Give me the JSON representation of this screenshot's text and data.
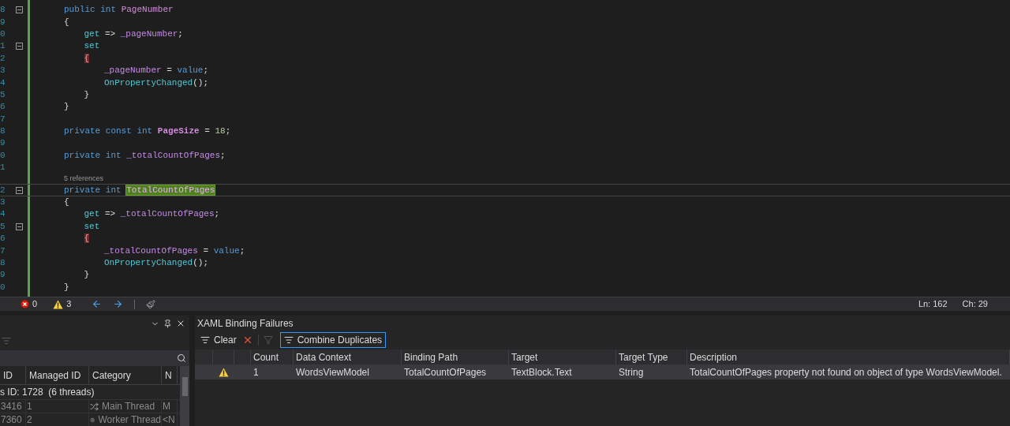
{
  "editor": {
    "lines": [
      {
        "kind": "code",
        "number": "8",
        "fold": true,
        "current": false,
        "tokens": [
          {
            "text": "public int ",
            "kind": "keyword"
          },
          {
            "text": "PageNumber",
            "kind": "property"
          }
        ]
      },
      {
        "kind": "code",
        "number": "9",
        "fold": false,
        "current": false,
        "tokens": [
          {
            "text": "{",
            "kind": "plain"
          }
        ],
        "children": [
          {
            "kind": "code",
            "number": "0",
            "fold": false,
            "current": false,
            "tokens": [
              {
                "text": "get",
                "kind": "accessor"
              },
              {
                "text": " => ",
                "kind": "plain"
              },
              {
                "text": "_pageNumber",
                "kind": "field"
              },
              {
                "text": ";",
                "kind": "plain"
              }
            ]
          },
          {
            "kind": "code",
            "number": "1",
            "fold": true,
            "current": false,
            "tokens": [
              {
                "text": "set",
                "kind": "accessor"
              }
            ]
          },
          {
            "kind": "code",
            "number": "2",
            "fold": false,
            "current": false,
            "tokens": [
              {
                "text": "{",
                "kind": "brace-match"
              }
            ],
            "children": [
              {
                "kind": "code",
                "number": "3",
                "fold": false,
                "current": false,
                "tokens": [
                  {
                    "text": "_pageNumber",
                    "kind": "field"
                  },
                  {
                    "text": " = ",
                    "kind": "plain"
                  },
                  {
                    "text": "value",
                    "kind": "keyword"
                  },
                  {
                    "text": ";",
                    "kind": "plain"
                  }
                ]
              },
              {
                "kind": "code",
                "number": "4",
                "fold": false,
                "current": false,
                "tokens": [
                  {
                    "text": "OnPropertyChanged",
                    "kind": "method"
                  },
                  {
                    "text": "();",
                    "kind": "plain"
                  }
                ]
              }
            ]
          },
          {
            "kind": "code",
            "number": "5",
            "fold": false,
            "current": false,
            "tokens": [
              {
                "text": "}",
                "kind": "plain"
              }
            ]
          }
        ]
      },
      {
        "kind": "code",
        "number": "6",
        "fold": false,
        "current": false,
        "tokens": [
          {
            "text": "}",
            "kind": "plain"
          }
        ]
      },
      {
        "kind": "code",
        "number": "7",
        "fold": false,
        "current": false
      },
      {
        "kind": "code",
        "number": "8",
        "fold": false,
        "current": false,
        "tokens": [
          {
            "text": "private const int ",
            "kind": "keyword"
          },
          {
            "text": "PageSize",
            "kind": "constant"
          },
          {
            "text": " = ",
            "kind": "plain"
          },
          {
            "text": "18",
            "kind": "number"
          },
          {
            "text": ";",
            "kind": "plain"
          }
        ]
      },
      {
        "kind": "code",
        "number": "9",
        "fold": false,
        "current": false
      },
      {
        "kind": "code",
        "number": "0",
        "fold": false,
        "current": false,
        "tokens": [
          {
            "text": "private int ",
            "kind": "keyword"
          },
          {
            "text": "_totalCountOfPages",
            "kind": "field"
          },
          {
            "text": ";",
            "kind": "plain"
          }
        ]
      },
      {
        "kind": "code",
        "number": "1",
        "fold": false,
        "current": false
      },
      {
        "kind": "codelens",
        "text": "5 references"
      },
      {
        "kind": "code",
        "number": "2",
        "fold": true,
        "current": true,
        "tokens": [
          {
            "text": "private int ",
            "kind": "keyword"
          },
          {
            "text": "TotalCountOfPages",
            "kind": "highlight"
          }
        ]
      },
      {
        "kind": "code",
        "number": "3",
        "fold": false,
        "current": false,
        "tokens": [
          {
            "text": "{",
            "kind": "plain"
          }
        ],
        "children": [
          {
            "kind": "code",
            "number": "4",
            "fold": false,
            "current": false,
            "tokens": [
              {
                "text": "get",
                "kind": "accessor"
              },
              {
                "text": " => ",
                "kind": "plain"
              },
              {
                "text": "_totalCountOfPages",
                "kind": "field"
              },
              {
                "text": ";",
                "kind": "plain"
              }
            ]
          },
          {
            "kind": "code",
            "number": "5",
            "fold": true,
            "current": false,
            "tokens": [
              {
                "text": "set",
                "kind": "accessor"
              }
            ]
          },
          {
            "kind": "code",
            "number": "6",
            "fold": false,
            "current": false,
            "tokens": [
              {
                "text": "{",
                "kind": "brace-match"
              }
            ],
            "children": [
              {
                "kind": "code",
                "number": "7",
                "fold": false,
                "current": false,
                "tokens": [
                  {
                    "text": "_totalCountOfPages",
                    "kind": "field"
                  },
                  {
                    "text": " = ",
                    "kind": "plain"
                  },
                  {
                    "text": "value",
                    "kind": "keyword"
                  },
                  {
                    "text": ";",
                    "kind": "plain"
                  }
                ]
              },
              {
                "kind": "code",
                "number": "8",
                "fold": false,
                "current": false,
                "tokens": [
                  {
                    "text": "OnPropertyChanged",
                    "kind": "method"
                  },
                  {
                    "text": "();",
                    "kind": "plain"
                  }
                ]
              }
            ]
          },
          {
            "kind": "code",
            "number": "9",
            "fold": false,
            "current": false,
            "tokens": [
              {
                "text": "}",
                "kind": "plain"
              }
            ]
          }
        ]
      },
      {
        "kind": "code",
        "number": "0",
        "fold": false,
        "current": false,
        "tokens": [
          {
            "text": "}",
            "kind": "plain"
          }
        ]
      }
    ]
  },
  "status_bar": {
    "errors": "0",
    "warnings": "3",
    "line": "Ln: 162",
    "column": "Ch: 29"
  },
  "threads_panel": {
    "columns": [
      "ID",
      "Managed ID",
      "Category",
      "N"
    ],
    "group": "s ID: 1728  (6 threads)",
    "rows": [
      {
        "kind": "main",
        "cells": [
          "3416",
          "1",
          "Main Thread",
          "M"
        ]
      },
      {
        "kind": "worker",
        "cells": [
          "7360",
          "2",
          "Worker Thread",
          "<N"
        ]
      }
    ]
  },
  "binding_failures": {
    "title": "XAML Binding Failures",
    "toolbar": {
      "clear": "Clear",
      "combine": {
        "label": "Combine Duplicates",
        "selected": true
      }
    },
    "columns": [
      "Count",
      "Data Context",
      "Binding Path",
      "Target",
      "Target Type",
      "Description"
    ],
    "rows": [
      {
        "kind": "warning",
        "cells": [
          "1",
          "WordsViewModel",
          "TotalCountOfPages",
          "TextBlock.Text",
          "String",
          "TotalCountOfPages property not found on object of type WordsViewModel."
        ]
      }
    ]
  }
}
